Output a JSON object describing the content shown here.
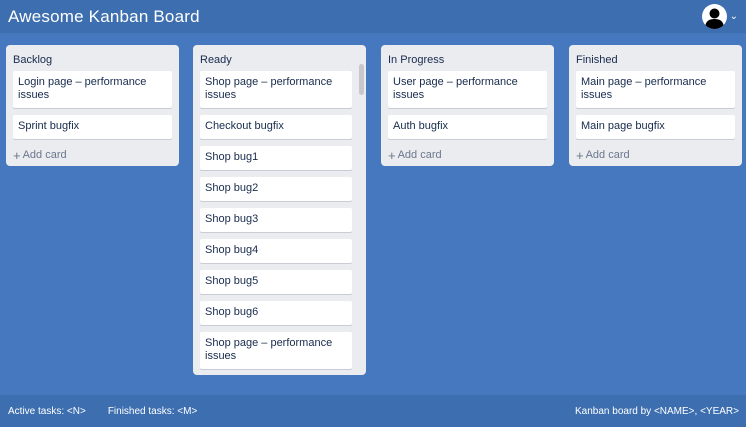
{
  "header": {
    "title": "Awesome Kanban Board",
    "user_menu_chevron": "⌄"
  },
  "columns": {
    "backlog": {
      "title": "Backlog",
      "cards": [
        "Login page – performance issues",
        "Sprint bugfix"
      ],
      "add_label": "Add card"
    },
    "ready": {
      "title": "Ready",
      "cards": [
        "Shop page – performance issues",
        "Checkout bugfix",
        "Shop bug1",
        "Shop bug2",
        "Shop bug3",
        "Shop bug4",
        "Shop bug5",
        "Shop bug6",
        "Shop page – performance issues"
      ]
    },
    "in_progress": {
      "title": "In Progress",
      "cards": [
        "User page – performance issues",
        "Auth bugfix"
      ],
      "add_label": "Add card"
    },
    "finished": {
      "title": "Finished",
      "cards": [
        "Main page – performance issues",
        "Main page bugfix"
      ],
      "add_label": "Add card"
    }
  },
  "footer": {
    "active_tasks": "Active tasks: <N>",
    "finished_tasks": "Finished tasks: <M>",
    "credit": "Kanban board by <NAME>, <YEAR>"
  },
  "icons": {
    "avatar": "user-avatar-icon",
    "plus": "+"
  },
  "colors": {
    "background": "#4578be",
    "header": "#3d6eb0",
    "column": "#ebecf0",
    "card": "#ffffff"
  }
}
